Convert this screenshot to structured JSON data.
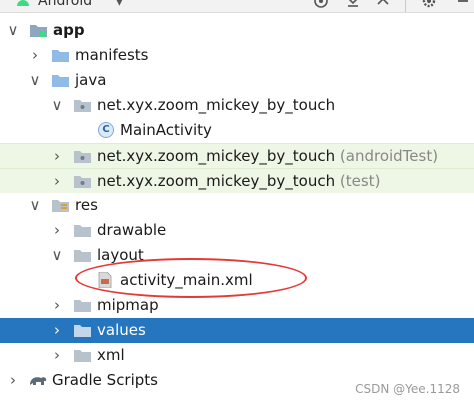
{
  "toolbar": {
    "title": "Android"
  },
  "tree": {
    "app": "app",
    "manifests": "manifests",
    "java": "java",
    "pkg_main": "net.xyx.zoom_mickey_by_touch",
    "main_activity": "MainActivity",
    "pkg_android_test": "net.xyx.zoom_mickey_by_touch",
    "android_test_suffix": "(androidTest)",
    "pkg_test": "net.xyx.zoom_mickey_by_touch",
    "test_suffix": "(test)",
    "res": "res",
    "drawable": "drawable",
    "layout": "layout",
    "activity_main": "activity_main.xml",
    "mipmap": "mipmap",
    "values": "values",
    "xml": "xml",
    "gradle_scripts": "Gradle Scripts"
  },
  "watermark": "CSDN @Yee.1128",
  "colors": {
    "selection": "#2675bf",
    "test_tint": "#eef6e6",
    "annotation": "#e53935",
    "folder": "#8fbbe6"
  }
}
